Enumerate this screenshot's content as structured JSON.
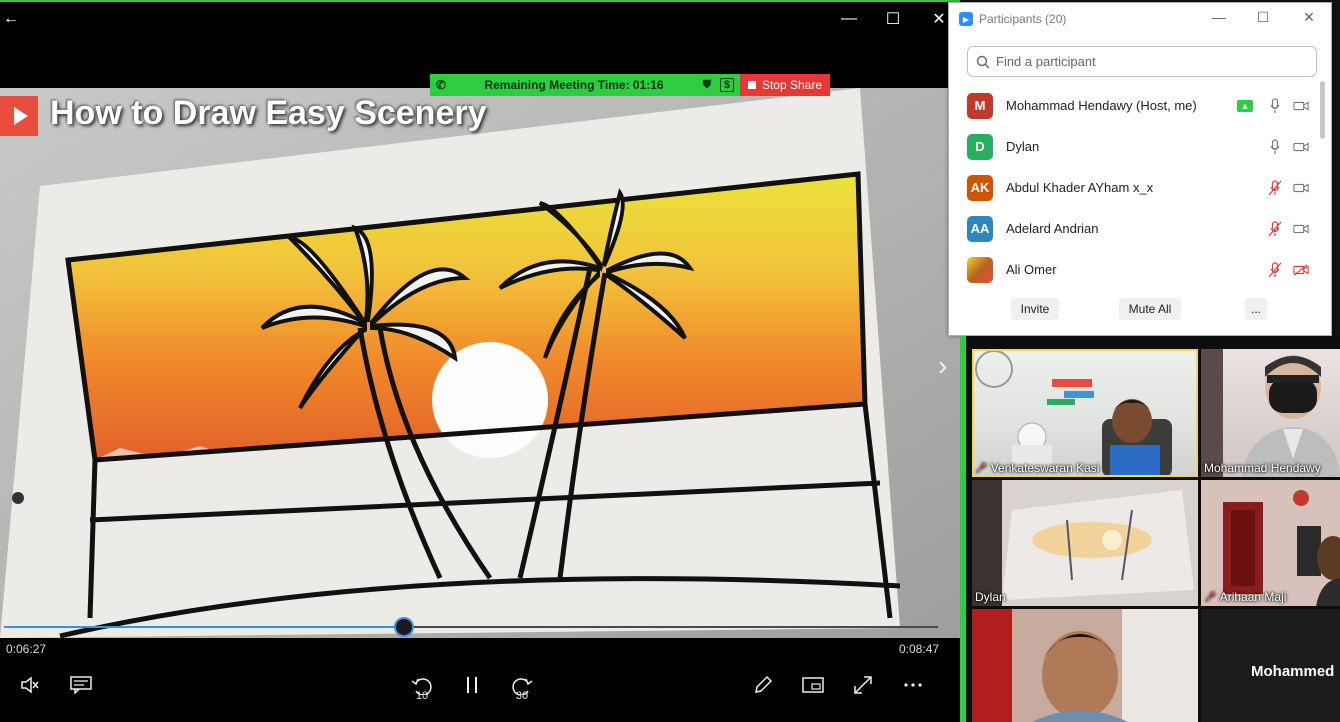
{
  "player": {
    "video_title": "How to Draw Easy Scenery",
    "time_current": "0:06:27",
    "time_total": "0:08:47",
    "progress_fraction": 0.428,
    "window_controls": {
      "back": "←",
      "minimize": "—",
      "maximize": "☐",
      "close": "✕"
    },
    "controls": {
      "rewind_label": "10",
      "forward_label": "30"
    }
  },
  "share_bar": {
    "remaining_time": "Remaining Meeting Time: 01:16",
    "stop_share_label": "Stop Share"
  },
  "participants_panel": {
    "title": "Participants (20)",
    "search_placeholder": "Find a participant",
    "participants": [
      {
        "initials": "M",
        "name": "Mohammad Hendawy (Host, me)",
        "color": "#c0392b",
        "mic": "on",
        "video": "on",
        "sharing": true
      },
      {
        "initials": "D",
        "name": "Dylan",
        "color": "#27ae60",
        "mic": "on",
        "video": "on",
        "sharing": false
      },
      {
        "initials": "AK",
        "name": "Abdul Khader AYham x_x",
        "color": "#d35400",
        "mic": "muted",
        "video": "on",
        "sharing": false
      },
      {
        "initials": "AA",
        "name": "Adelard Andrian",
        "color": "#2e86c1",
        "mic": "muted",
        "video": "on",
        "sharing": false
      },
      {
        "initials": "",
        "name": "Ali Omer",
        "color": "#b5651d",
        "mic": "muted",
        "video": "off",
        "sharing": false
      }
    ],
    "invite_label": "Invite",
    "mute_all_label": "Mute All",
    "more_label": "..."
  },
  "gallery": {
    "tiles": [
      {
        "name": "Venkateswaran Kasi",
        "muted": true
      },
      {
        "name": "Mohammad Hendawy",
        "muted": false
      },
      {
        "name": "Dylan",
        "muted": false
      },
      {
        "name": "Arihaan Maji",
        "muted": true
      },
      {
        "name": "",
        "muted": false
      },
      {
        "name": "Mohammed",
        "muted": false
      }
    ]
  },
  "colors": {
    "accent_green": "#2ecc40",
    "stop_red": "#e53935",
    "progress_blue": "#3d8fe0",
    "muted_red": "#e53935"
  }
}
